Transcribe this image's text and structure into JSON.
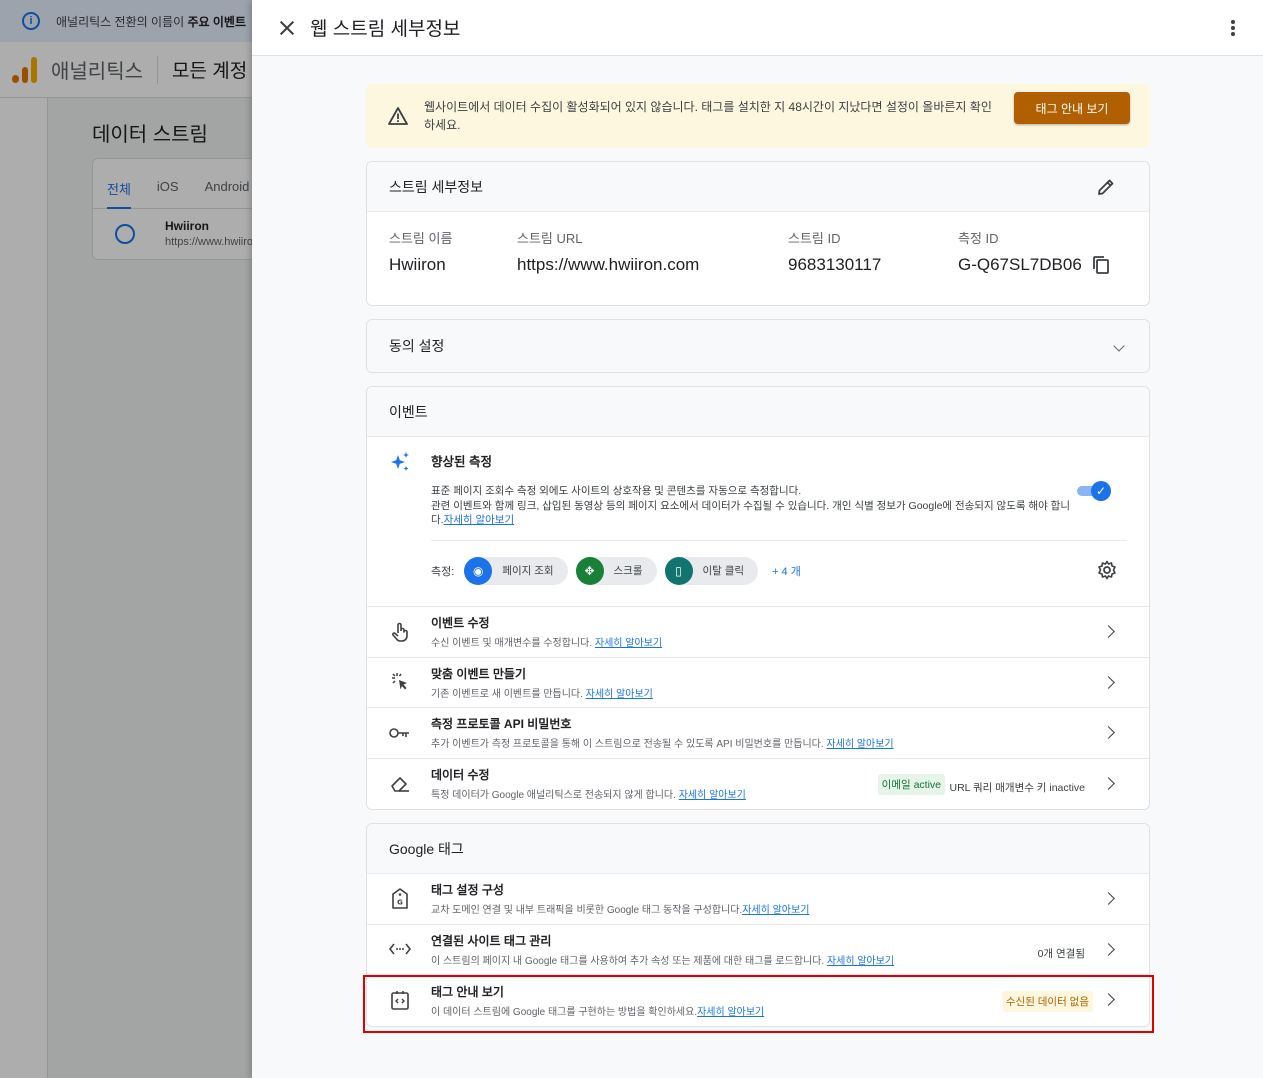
{
  "background": {
    "banner_text_plain": "애널리틱스 전환의 이름이 ",
    "banner_text_bold": "주요 이벤트",
    "app_name": "애널리틱스",
    "account": "모든 계정",
    "page_title": "데이터 스트림",
    "tabs": [
      "전체",
      "iOS",
      "Android"
    ],
    "stream_name": "Hwiiron",
    "stream_url": "https://www.hwiiron.com"
  },
  "drawer": {
    "title": "웹 스트림 세부정보",
    "warning": {
      "text": "웹사이트에서 데이터 수집이 활성화되어 있지 않습니다. 태그를 설치한 지 48시간이 지났다면 설정이 올바른지 확인하세요.",
      "button": "태그 안내 보기"
    },
    "stream_details": {
      "header": "스트림 세부정보",
      "fields": [
        {
          "label": "스트림 이름",
          "value": "Hwiiron"
        },
        {
          "label": "스트림 URL",
          "value": "https://www.hwiiron.com"
        },
        {
          "label": "스트림 ID",
          "value": "9683130117"
        },
        {
          "label": "측정 ID",
          "value": "G-Q67SL7DB06"
        }
      ]
    },
    "consent": {
      "label": "동의 설정"
    },
    "events": {
      "header": "이벤트",
      "enhanced": {
        "title": "향상된 측정",
        "desc_line1": "표준 페이지 조회수 측정 외에도 사이트의 상호작용 및 콘텐츠를 자동으로 측정합니다.",
        "desc_line2": "관련 이벤트와 함께 링크, 삽입된 동영상 등의 페이지 요소에서 데이터가 수집될 수 있습니다. 개인 식별 정보가 Google에 전송되지 않도록 해야 합니다.",
        "learn_more": "자세히 알아보기",
        "measure_label": "측정:",
        "chips": [
          {
            "label": "페이지 조회",
            "color": "#1a73e8"
          },
          {
            "label": "스크롤",
            "color": "#188038"
          },
          {
            "label": "이탈 클릭",
            "color": "#12736f"
          }
        ],
        "more": "+ 4 개"
      },
      "rows": [
        {
          "title": "이벤트 수정",
          "desc": "수신 이벤트 및 매개변수를 수정합니다. ",
          "link": "자세히 알아보기"
        },
        {
          "title": "맞춤 이벤트 만들기",
          "desc": "기존 이벤트로 새 이벤트를 만듭니다. ",
          "link": "자세히 알아보기"
        },
        {
          "title": "측정 프로토콜 API 비밀번호",
          "desc": "추가 이벤트가 측정 프로토콜을 통해 이 스트림으로 전송될 수 있도록 API 비밀번호를 만듭니다. ",
          "link": "자세히 알아보기"
        },
        {
          "title": "데이터 수정",
          "desc": "특정 데이터가 Google 애널리틱스로 전송되지 않게 합니다. ",
          "link": "자세히 알아보기",
          "badge1": "이메일 active",
          "badge2": "URL 쿼리 매개변수 키 inactive"
        }
      ]
    },
    "google_tag": {
      "header": "Google 태그",
      "rows": [
        {
          "title": "태그 설정 구성",
          "desc": "교차 도메인 연결 및 내부 트래픽을 비롯한 Google 태그 동작을 구성합니다.",
          "link": "자세히 알아보기"
        },
        {
          "title": "연결된 사이트 태그 관리",
          "desc": "이 스트림의 페이지 내 Google 태그를 사용하여 추가 속성 또는 제품에 대한 태그를 로드합니다. ",
          "link": "자세히 알아보기",
          "badge": "0개 연결됨"
        },
        {
          "title": "태그 안내 보기",
          "desc": "이 데이터 스트림에 Google 태그를 구현하는 방법을 확인하세요.",
          "link": "자세히 알아보기",
          "badge": "수신된 데이터 없음"
        }
      ]
    }
  }
}
